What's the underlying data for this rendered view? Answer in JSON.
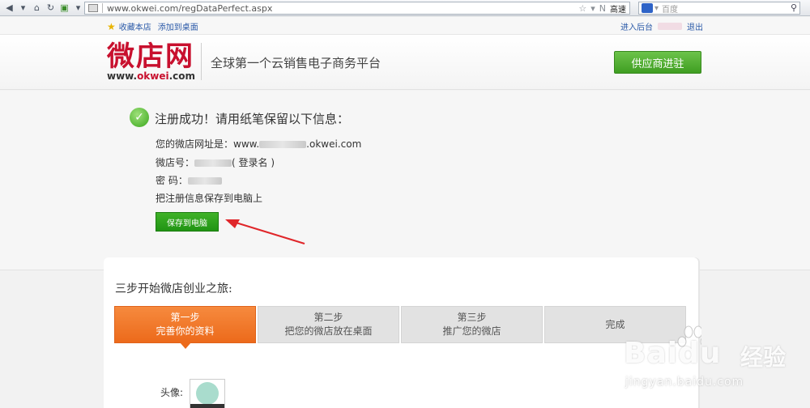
{
  "browser": {
    "url": "www.okwei.com/regDataPerfect.aspx",
    "speed_label": "高速",
    "search_placeholder": "百度"
  },
  "utilbar": {
    "favorite": "收藏本店",
    "add_desktop": "添加到桌面",
    "backend": "进入后台",
    "logout": "退出"
  },
  "header": {
    "logo_cn": "微店网",
    "logo_en_prefix": "www.",
    "logo_en_brand": "okwei",
    "logo_en_suffix": ".com",
    "slogan": "全球第一个云销售电子商务平台",
    "supplier_button": "供应商进驻"
  },
  "success": {
    "title": "注册成功！请用纸笔保留以下信息：",
    "url_label": "您的微店网址是：www.",
    "url_suffix": ".okwei.com",
    "id_label": "微店号：",
    "id_suffix": "( 登录名 )",
    "password_label": "密 码：",
    "save_hint": "把注册信息保存到电脑上",
    "save_button": "保存到电脑"
  },
  "steps_card": {
    "title": "三步开始微店创业之旅:",
    "steps": [
      {
        "line1": "第一步",
        "line2": "完善你的资料",
        "active": true
      },
      {
        "line1": "第二步",
        "line2": "把您的微店放在桌面",
        "active": false
      },
      {
        "line1": "第三步",
        "line2": "推广您的微店",
        "active": false
      },
      {
        "line1": "完成",
        "line2": "",
        "active": false
      }
    ],
    "avatar_label": "头像:"
  },
  "watermark": {
    "brand": "Bai",
    "brand2": "du",
    "cn": "经验",
    "url": "jingyan.baidu.com"
  },
  "colors": {
    "brand_red": "#c8102e",
    "green": "#3f9e22",
    "orange": "#ec6a1b"
  }
}
